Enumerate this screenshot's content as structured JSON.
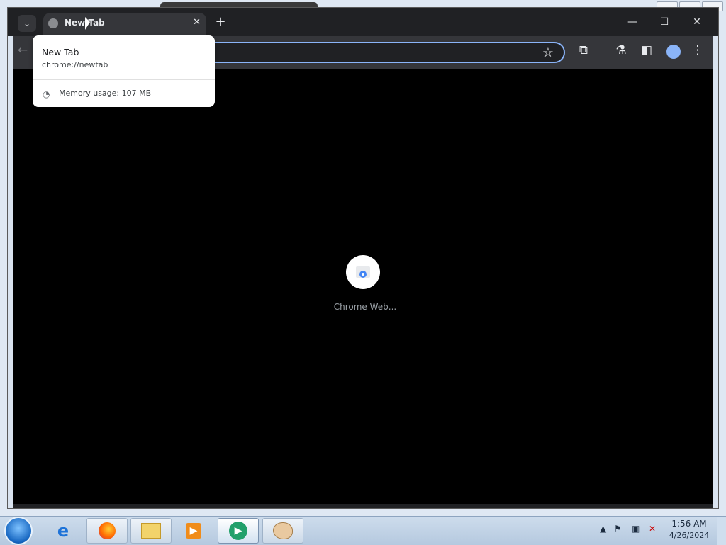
{
  "browser": {
    "tab": {
      "title": "New Tab"
    },
    "new_tab_symbol": "+",
    "window_controls": {
      "minimize": "—",
      "maximize": "☐",
      "close": "✕"
    },
    "toolbar": {
      "star_icon": "star-icon",
      "extensions_icon": "puzzle-icon",
      "labs_icon": "flask-icon",
      "sidepanel_icon": "side-panel-icon",
      "profile_icon": "profile-icon",
      "menu_icon": "kebab-menu-icon"
    },
    "accent_color": "#8ab4f8"
  },
  "hover_card": {
    "title": "New Tab",
    "url": "chrome://newtab",
    "memory": "Memory usage: 107 MB"
  },
  "content": {
    "center_label": "Chrome Web..."
  },
  "taskbar": {
    "apps": [
      "internet-explorer-icon",
      "firefox-icon",
      "file-explorer-icon",
      "media-player-icon",
      "chrome-remote-icon",
      "paint-icon"
    ],
    "clock": {
      "time": "1:56 AM",
      "date": "4/26/2024"
    }
  }
}
